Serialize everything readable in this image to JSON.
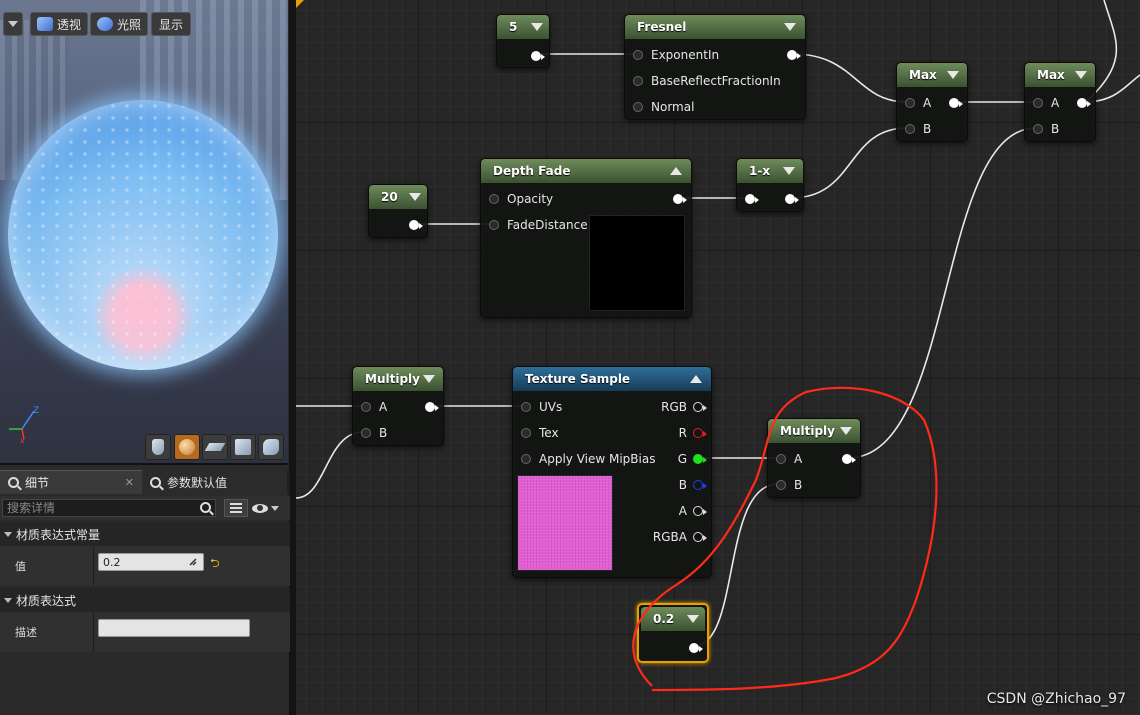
{
  "viewport": {
    "persp_label": "透视",
    "light_label": "光照",
    "show_label": "显示"
  },
  "tabs": {
    "details": "细节",
    "params": "参数默认值"
  },
  "search": {
    "placeholder": "搜索详情"
  },
  "categories": {
    "constant": "材质表达式常量",
    "expression": "材质表达式"
  },
  "props": {
    "value_label": "值",
    "value": "0.2",
    "desc_label": "描述"
  },
  "nodes": {
    "const5": {
      "value": "5"
    },
    "fresnel": {
      "title": "Fresnel",
      "pins": [
        "ExponentIn",
        "BaseReflectFractionIn",
        "Normal"
      ]
    },
    "max1": {
      "title": "Max",
      "a": "A",
      "b": "B"
    },
    "max2": {
      "title": "Max",
      "a": "A",
      "b": "B"
    },
    "const20": {
      "value": "20"
    },
    "depthfade": {
      "title": "Depth Fade",
      "pins": [
        "Opacity",
        "FadeDistance"
      ]
    },
    "oneminus": {
      "title": "1-x"
    },
    "multiply1": {
      "title": "Multiply",
      "a": "A",
      "b": "B"
    },
    "texsample": {
      "title": "Texture Sample",
      "inputs": [
        "UVs",
        "Tex",
        "Apply View MipBias"
      ],
      "outputs": [
        "RGB",
        "R",
        "G",
        "B",
        "A",
        "RGBA"
      ]
    },
    "multiply2": {
      "title": "Multiply",
      "a": "A",
      "b": "B"
    },
    "const02": {
      "value": "0.2"
    }
  },
  "watermark": "CSDN @Zhichao_97",
  "colors": {
    "accent_selected": "#e8a000",
    "annotation_red": "#ff2a1a",
    "pin_green": "#20e020",
    "pin_red": "#e02020",
    "pin_blue": "#2040e8"
  }
}
